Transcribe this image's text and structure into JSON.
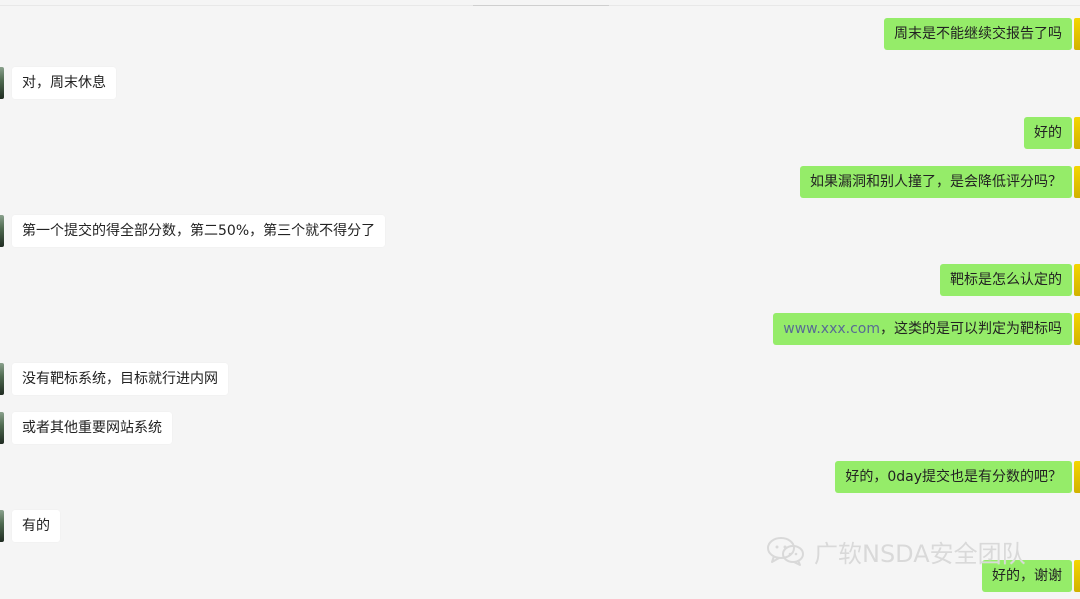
{
  "messages": [
    {
      "side": "right",
      "text": "周末是不能继续交报告了吗"
    },
    {
      "side": "left",
      "text": "对，周末休息"
    },
    {
      "side": "right",
      "text": "好的"
    },
    {
      "side": "right",
      "text": "如果漏洞和别人撞了，是会降低评分吗？"
    },
    {
      "side": "left",
      "text": "第一个提交的得全部分数，第二50%，第三个就不得分了"
    },
    {
      "side": "right",
      "text": "靶标是怎么认定的"
    },
    {
      "side": "right",
      "link_text": "www.xxx.com",
      "rest_text": "，这类的是可以判定为靶标吗"
    },
    {
      "side": "left",
      "text": "没有靶标系统，目标就行进内网"
    },
    {
      "side": "left",
      "text": "或者其他重要网站系统"
    },
    {
      "side": "right",
      "text": "好的，0day提交也是有分数的吧？"
    },
    {
      "side": "left",
      "text": "有的"
    },
    {
      "side": "right",
      "text": "好的，谢谢"
    }
  ],
  "watermark": {
    "text": "广软NSDA安全团队",
    "icon": "wechat-icon"
  },
  "colors": {
    "background": "#f5f5f5",
    "incoming_bubble": "#ffffff",
    "outgoing_bubble": "#95ec69",
    "link": "#586b95"
  }
}
